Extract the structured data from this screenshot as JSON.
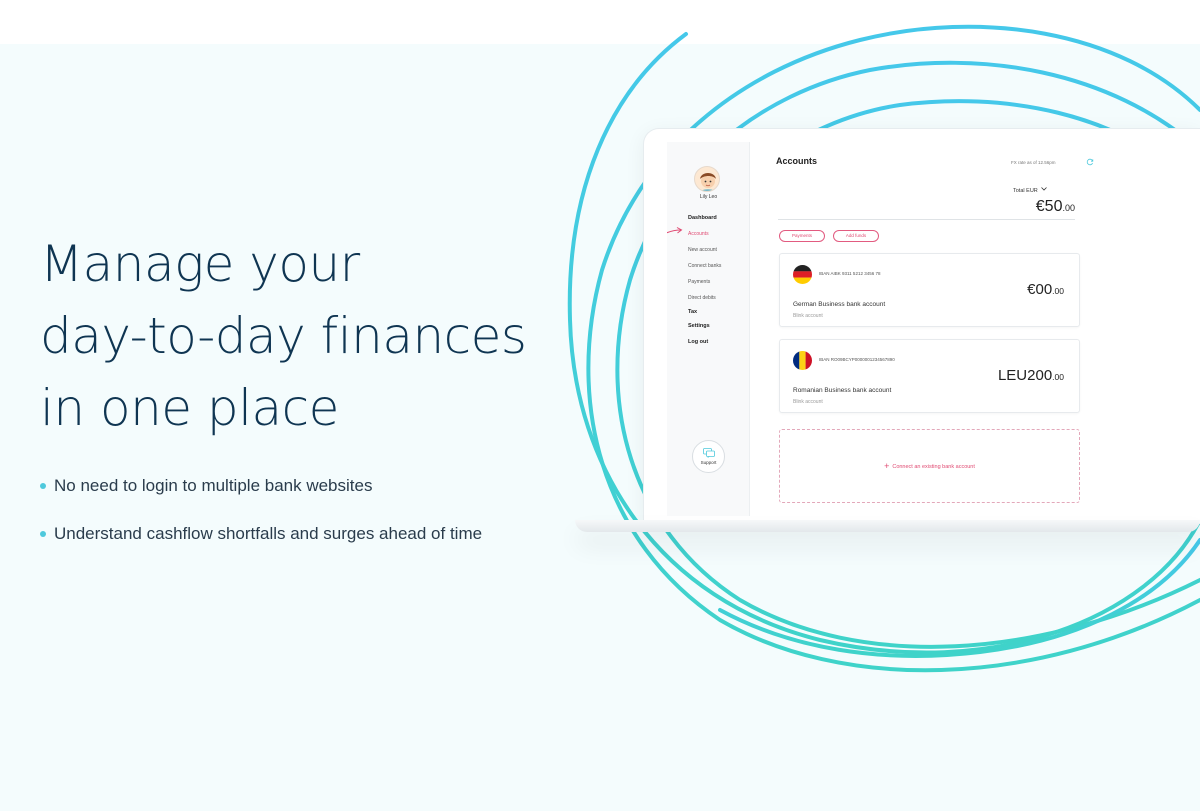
{
  "hero": {
    "headline_lines": [
      "Manage your",
      "day-to-day finances",
      "in one place"
    ],
    "bullets": [
      "No need to login to multiple bank websites",
      "Understand cashflow shortfalls and surges ahead of time"
    ]
  },
  "colors": {
    "headline": "#0f3552",
    "accent_teal": "#4ec9dc",
    "accent_pink": "#e04a72",
    "background": "#f4fcfd"
  },
  "app": {
    "user": {
      "name": "Lily Leo"
    },
    "nav": [
      {
        "label": "Dashboard"
      },
      {
        "label": "Accounts"
      },
      {
        "label": "New account"
      },
      {
        "label": "Connect banks"
      },
      {
        "label": "Payments"
      },
      {
        "label": "Direct debits"
      },
      {
        "label": "Tax"
      },
      {
        "label": "Settings"
      },
      {
        "label": "Log out"
      }
    ],
    "support_label": "Support",
    "main": {
      "title": "Accounts",
      "fx_rate": "FX rate as of 12.56pm",
      "total_label": "Total EUR",
      "total_value_int": "€50",
      "total_value_dec": ".00",
      "actions": [
        "Payments",
        "Add funds"
      ],
      "accounts": [
        {
          "flag": "germany-flag-icon",
          "iban": "IBAN AIBK 9311 5212 3456 78",
          "name": "German Business bank account",
          "provider": "Blink account",
          "amount_int": "€00",
          "amount_dec": ".00"
        },
        {
          "flag": "romania-flag-icon",
          "iban": "IBAN RO09BCYP0000001234567890",
          "name": "Romanian Business bank account",
          "provider": "Blink account",
          "amount_int": "LEU200",
          "amount_dec": ".00"
        }
      ],
      "connect_label": "Connect an existing bank account"
    }
  }
}
